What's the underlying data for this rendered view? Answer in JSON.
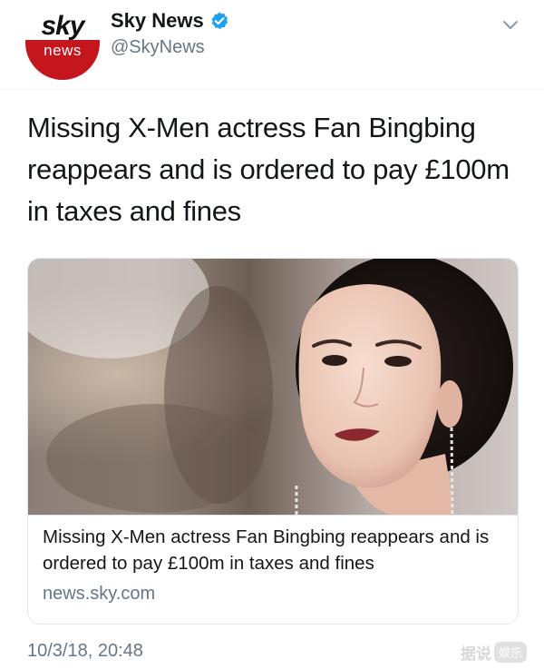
{
  "account": {
    "logo_top": "sky",
    "logo_bottom": "news",
    "display_name": "Sky News",
    "handle": "@SkyNews",
    "verified": true
  },
  "tweet": {
    "text": "Missing X-Men actress Fan Bingbing reappears and is ordered to pay £100m in taxes and fines",
    "timestamp": "10/3/18, 20:48"
  },
  "card": {
    "title": "Missing X-Men actress Fan Bingbing reappears and is ordered to pay £100m in taxes and fines",
    "domain": "news.sky.com"
  },
  "watermark": {
    "text": "据说",
    "badge": "娱乐"
  },
  "icons": {
    "verified": "verified-badge-icon",
    "menu": "chevron-down-icon"
  },
  "colors": {
    "verified_blue": "#1da1f2",
    "sky_red": "#c4161c",
    "secondary_text": "#657786",
    "primary_text": "#14171a"
  }
}
